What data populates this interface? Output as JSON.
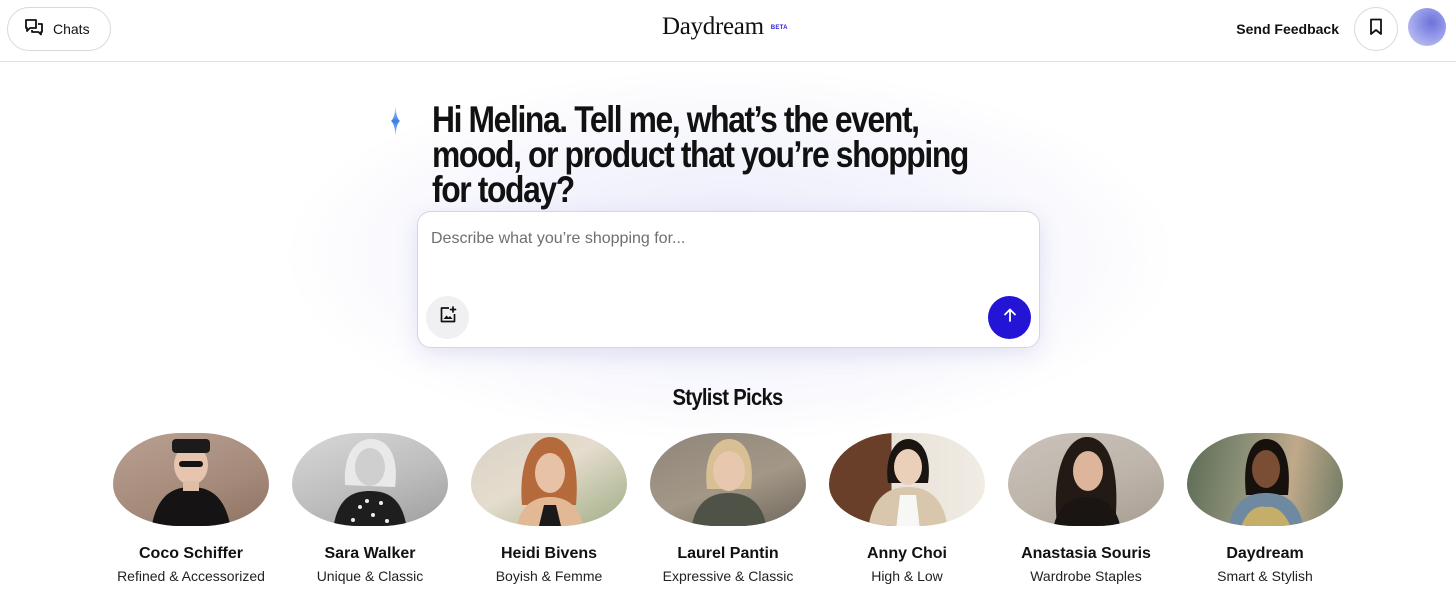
{
  "header": {
    "chats_label": "Chats",
    "logo_text": "Daydream",
    "beta_label": "BETA",
    "feedback_label": "Send Feedback",
    "bookmark_icon": "bookmark-icon",
    "chats_icon": "chat-bubbles-icon"
  },
  "hero": {
    "headline": "Hi Melina. Tell me, what’s the event, mood, or product that you’re shopping for today?",
    "sparkle_icon": "sparkle-icon"
  },
  "prompt": {
    "placeholder": "Describe what you’re shopping for...",
    "value": "",
    "image_upload_icon": "image-upload-icon",
    "submit_icon": "arrow-up-icon"
  },
  "picks": {
    "title": "Stylist Picks",
    "items": [
      {
        "name": "Coco Schiffer",
        "desc": "Refined & Accessorized"
      },
      {
        "name": "Sara Walker",
        "desc": "Unique & Classic"
      },
      {
        "name": "Heidi Bivens",
        "desc": "Boyish & Femme"
      },
      {
        "name": "Laurel Pantin",
        "desc": "Expressive & Classic"
      },
      {
        "name": "Anny Choi",
        "desc": "High & Low"
      },
      {
        "name": "Anastasia Souris",
        "desc": "Wardrobe Staples"
      },
      {
        "name": "Daydream",
        "desc": "Smart & Stylish"
      }
    ]
  },
  "colors": {
    "accent": "#2414d6",
    "beta": "#2a1ee0",
    "border": "#d9d9d9"
  }
}
